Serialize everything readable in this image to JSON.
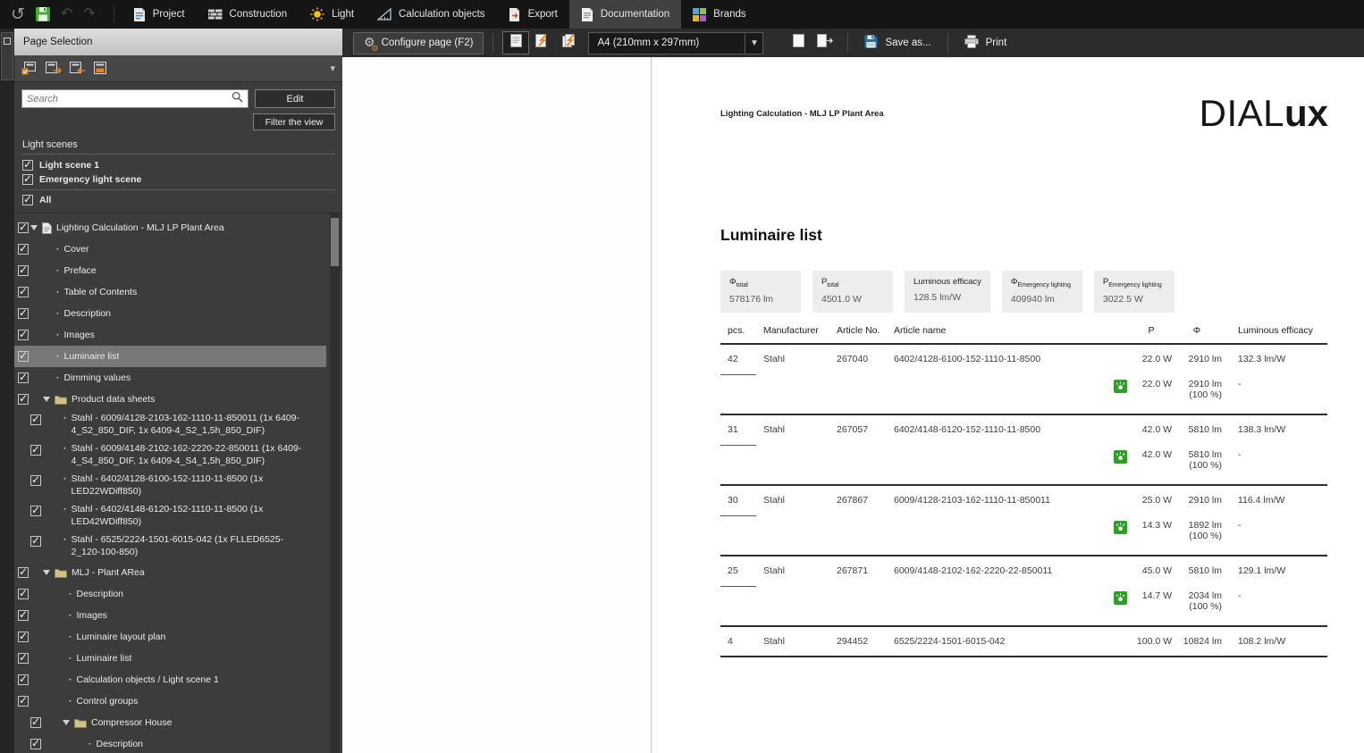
{
  "topbar": {
    "tabs": [
      {
        "id": "project",
        "label": "Project"
      },
      {
        "id": "construction",
        "label": "Construction"
      },
      {
        "id": "light",
        "label": "Light"
      },
      {
        "id": "calculation-objects",
        "label": "Calculation objects"
      },
      {
        "id": "export",
        "label": "Export"
      },
      {
        "id": "documentation",
        "label": "Documentation",
        "active": true
      },
      {
        "id": "brands",
        "label": "Brands"
      }
    ]
  },
  "sidebar": {
    "title": "Page Selection",
    "search_placeholder": "Search",
    "edit_label": "Edit",
    "filter_label": "Filter the view",
    "light_scenes_label": "Light scenes",
    "scenes": [
      {
        "label": "Light scene 1",
        "checked": true
      },
      {
        "label": "Emergency light scene",
        "checked": true
      },
      {
        "label": "All",
        "checked": true,
        "divider_above": true
      }
    ],
    "tree": [
      {
        "type": "root",
        "label": "Lighting Calculation - MLJ LP Plant Area",
        "checked": true
      },
      {
        "type": "page1",
        "label": "Cover",
        "checked": true
      },
      {
        "type": "page1",
        "label": "Preface",
        "checked": true
      },
      {
        "type": "page1",
        "label": "Table of Contents",
        "checked": true
      },
      {
        "type": "page1",
        "label": "Description",
        "checked": true
      },
      {
        "type": "page1",
        "label": "Images",
        "checked": true
      },
      {
        "type": "page1",
        "label": "Luminaire list",
        "checked": true,
        "selected": true
      },
      {
        "type": "page1",
        "label": "Dimming values",
        "checked": true
      },
      {
        "type": "folder1",
        "label": "Product data sheets",
        "checked": true
      },
      {
        "type": "product2",
        "label": "Stahl - 6009/4128-2103-162-1110-11-850011 (1x 6409-4_S2_850_DIF, 1x 6409-4_S2_1,5h_850_DIF)",
        "checked": true
      },
      {
        "type": "product2",
        "label": "Stahl - 6009/4148-2102-162-2220-22-850011 (1x 6409-4_S4_850_DIF, 1x 6409-4_S4_1,5h_850_DIF)",
        "checked": true
      },
      {
        "type": "product2",
        "label": "Stahl - 6402/4128-6100-152-1110-11-8500 (1x LED22WDiff850)",
        "checked": true
      },
      {
        "type": "product2",
        "label": "Stahl - 6402/4148-6120-152-1110-11-8500 (1x LED42WDiff850)",
        "checked": true
      },
      {
        "type": "product2",
        "label": "Stahl - 6525/2224-1501-6015-042 (1x FLLED6525-2_120-100-850)",
        "checked": true
      },
      {
        "type": "folder1",
        "label": "MLJ - Plant ARea",
        "checked": true
      },
      {
        "type": "page2",
        "label": "Description",
        "checked": true
      },
      {
        "type": "page2",
        "label": "Images",
        "checked": true
      },
      {
        "type": "page2",
        "label": "Luminaire layout plan",
        "checked": true
      },
      {
        "type": "page2",
        "label": "Luminaire list",
        "checked": true
      },
      {
        "type": "page2",
        "label": "Calculation objects / Light scene 1",
        "checked": true
      },
      {
        "type": "page2",
        "label": "Control groups",
        "checked": true
      },
      {
        "type": "folder2",
        "label": "Compressor House",
        "checked": true
      },
      {
        "type": "page3",
        "label": "Description",
        "checked": true
      }
    ]
  },
  "doc_toolbar": {
    "configure_label": "Configure page (F2)",
    "page_size_value": "A4 (210mm x 297mm)",
    "save_as_label": "Save as...",
    "print_label": "Print"
  },
  "document": {
    "page_header": "Lighting Calculation - MLJ LP Plant Area",
    "logo_part1": "DIAL",
    "logo_part2": "ux",
    "title": "Luminaire list",
    "summary": [
      {
        "symbol": "Φ",
        "sub": "total",
        "value": "578176 lm"
      },
      {
        "symbol": "P",
        "sub": "total",
        "value": "4501.0 W"
      },
      {
        "symbol": "Luminous efficacy",
        "sub": "",
        "value": "128.5 lm/W"
      },
      {
        "symbol": "Φ",
        "sub": "Emergency lighting",
        "value": "409940 lm"
      },
      {
        "symbol": "P",
        "sub": "Emergency lighting",
        "value": "3022.5 W"
      }
    ],
    "table": {
      "headers": {
        "pcs": "pcs.",
        "manufacturer": "Manufacturer",
        "article_no": "Article No.",
        "article_name": "Article name",
        "p": "P",
        "phi": "Φ",
        "efficacy": "Luminous efficacy"
      },
      "groups": [
        {
          "pcs": "42",
          "manufacturer": "Stahl",
          "article_no": "267040",
          "article_name": "6402/4128-6100-152-1110-11-8500",
          "p": "22.0 W",
          "phi": "2910 lm",
          "efficacy": "132.3 lm/W",
          "emergency": {
            "p": "22.0 W",
            "phi": "2910 lm",
            "phi_pct": "(100 %)",
            "efficacy": "-"
          }
        },
        {
          "pcs": "31",
          "manufacturer": "Stahl",
          "article_no": "267057",
          "article_name": "6402/4148-6120-152-1110-11-8500",
          "p": "42.0 W",
          "phi": "5810 lm",
          "efficacy": "138.3 lm/W",
          "emergency": {
            "p": "42.0 W",
            "phi": "5810 lm",
            "phi_pct": "(100 %)",
            "efficacy": "-"
          }
        },
        {
          "pcs": "30",
          "manufacturer": "Stahl",
          "article_no": "267867",
          "article_name": "6009/4128-2103-162-1110-11-850011",
          "p": "25.0 W",
          "phi": "2910 lm",
          "efficacy": "116.4 lm/W",
          "emergency": {
            "p": "14.3 W",
            "phi": "1892 lm",
            "phi_pct": "(100 %)",
            "efficacy": "-"
          }
        },
        {
          "pcs": "25",
          "manufacturer": "Stahl",
          "article_no": "267871",
          "article_name": "6009/4148-2102-162-2220-22-850011",
          "p": "45.0 W",
          "phi": "5810 lm",
          "efficacy": "129.1 lm/W",
          "emergency": {
            "p": "14.7 W",
            "phi": "2034 lm",
            "phi_pct": "(100 %)",
            "efficacy": "-"
          }
        },
        {
          "pcs": "4",
          "manufacturer": "Stahl",
          "article_no": "294452",
          "article_name": "6525/2224-1501-6015-042",
          "p": "100.0 W",
          "phi": "10824 lm",
          "efficacy": "108.2 lm/W",
          "emergency": null
        }
      ]
    }
  }
}
